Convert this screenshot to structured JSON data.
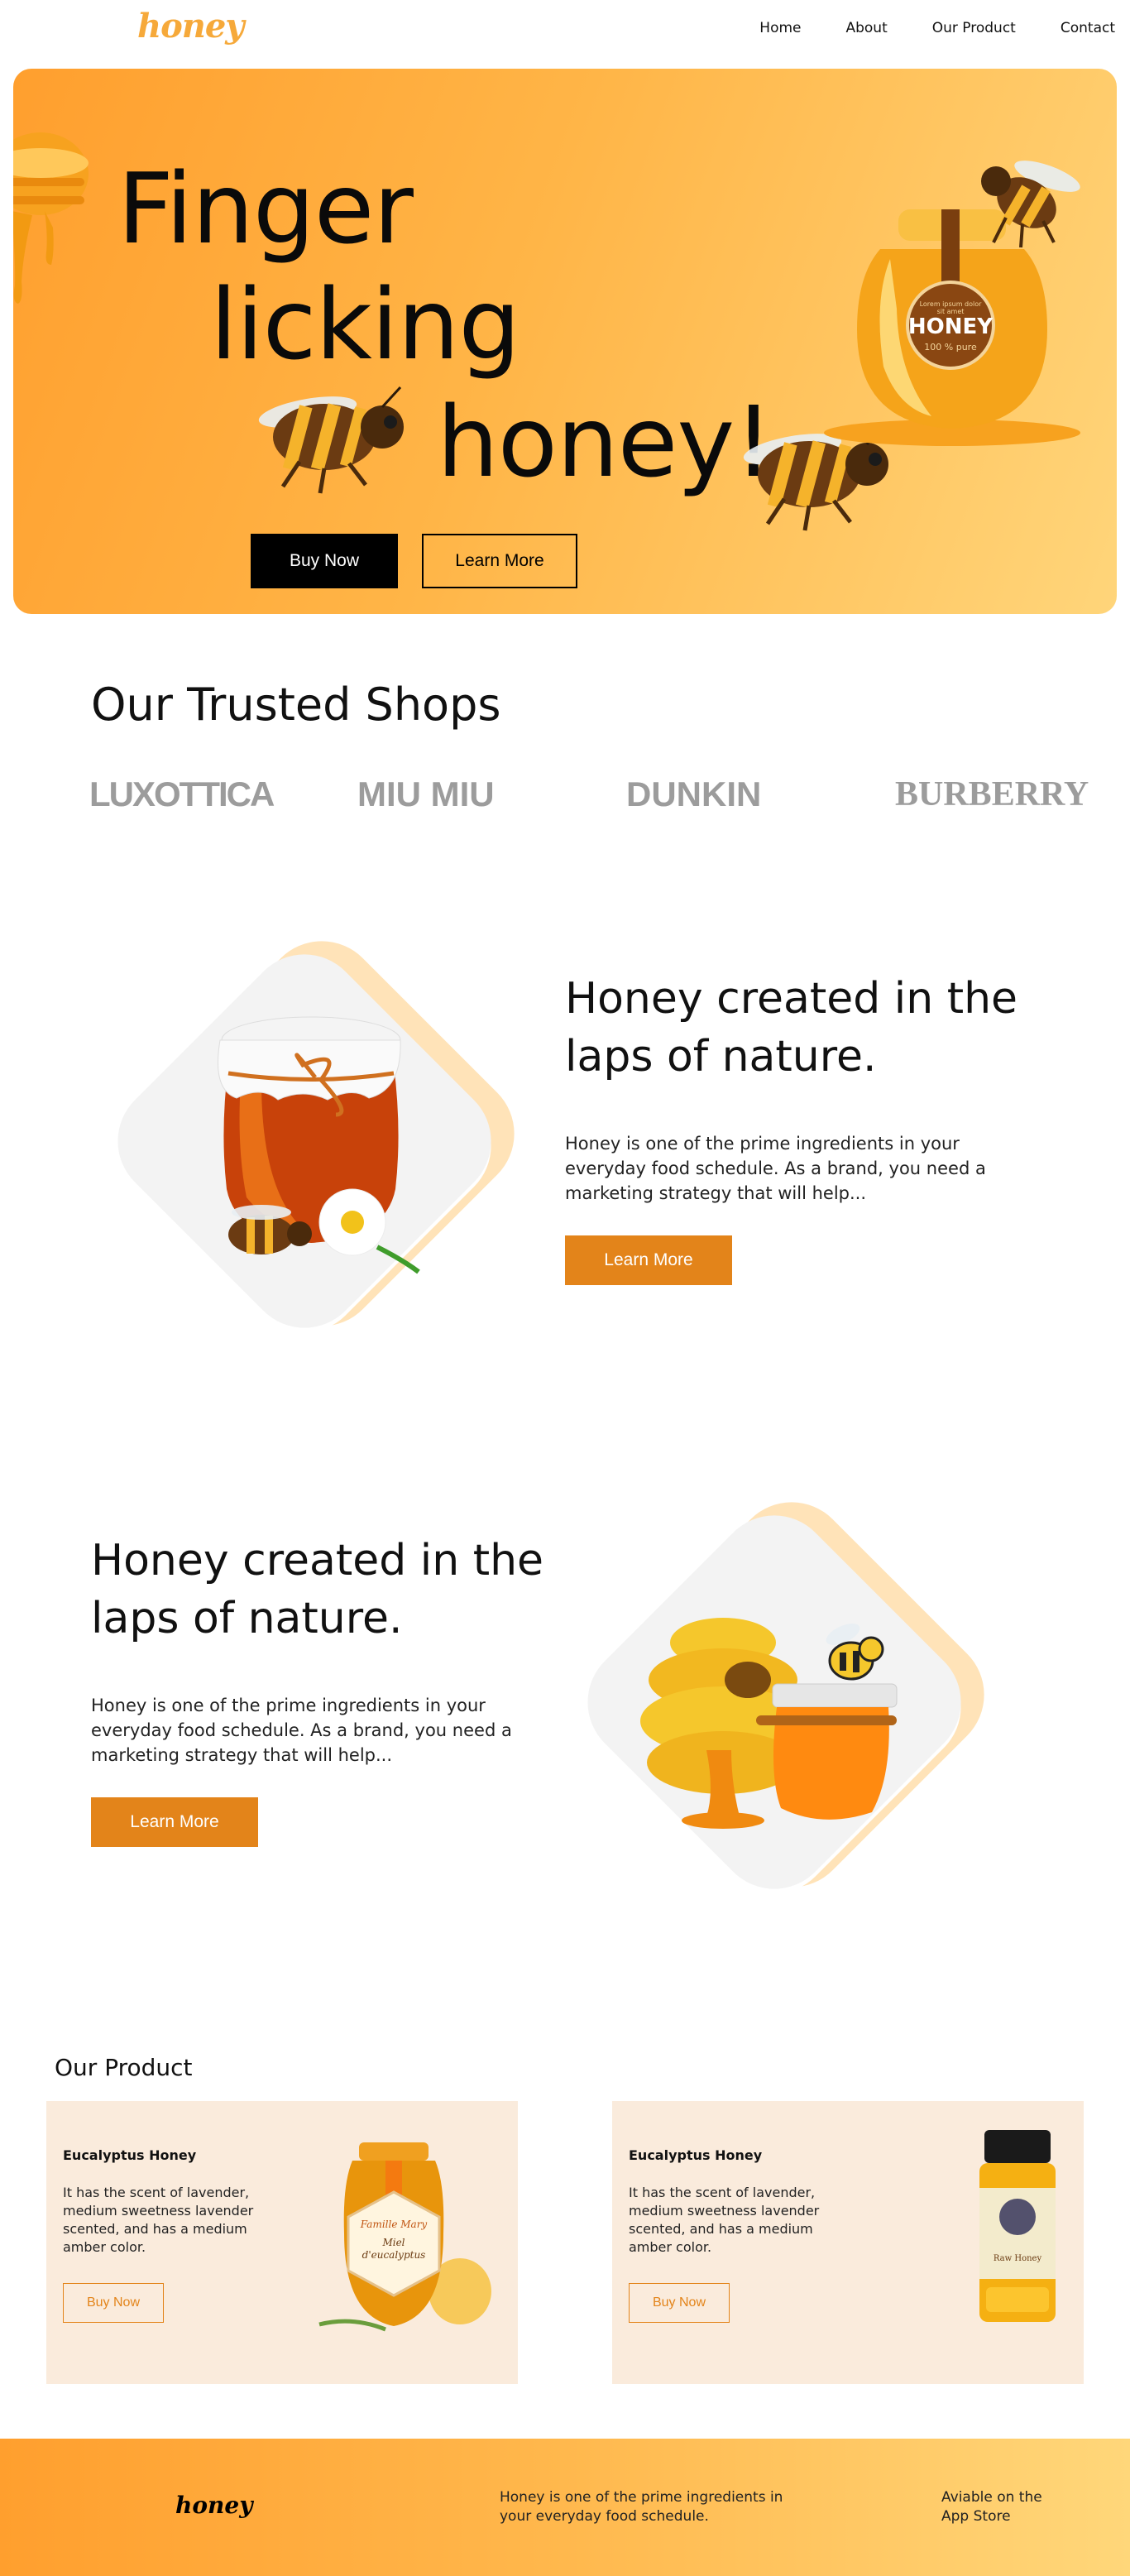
{
  "nav": {
    "logo": "honey",
    "links": [
      "Home",
      "About",
      "Our Product",
      "Contact"
    ]
  },
  "hero": {
    "line1": "Finger",
    "line2": "licking",
    "line3": "honey!",
    "buy_label": "Buy Now",
    "learn_label": "Learn More",
    "jar_label": "HONEY",
    "jar_sub": "100 % pure",
    "jar_small": "Lorem ipsum dolor sit amet"
  },
  "shops": {
    "title": "Our Trusted Shops",
    "brands": [
      "LUXOTTICA",
      "MIU MIU",
      "DUNKIN",
      "BURBERRY"
    ]
  },
  "feature1": {
    "title": "Honey created in the laps of nature.",
    "text": "Honey is one of the prime ingredients in your everyday food schedule. As a brand, you need a marketing strategy that will help...",
    "button": "Learn More"
  },
  "feature2": {
    "title": "Honey created in the laps of nature.",
    "text": "Honey is one of the prime ingredients in your everyday food schedule. As a brand, you need a marketing strategy that will help...",
    "button": "Learn More"
  },
  "products": {
    "heading": "Our Product",
    "items": [
      {
        "title": "Eucalyptus Honey",
        "text": "It has the scent of lavender, medium sweetness lavender scented, and has a medium amber color.",
        "button": "Buy Now",
        "jar_brand": "Famille Mary",
        "jar_name": "Miel d'eucalyptus"
      },
      {
        "title": "Eucalyptus Honey",
        "text": "It has the scent of lavender, medium sweetness lavender scented, and has a medium amber color.",
        "button": "Buy Now",
        "jar_name": "Raw Honey"
      }
    ]
  },
  "footer": {
    "logo": "honey",
    "text": "Honey is one of the prime ingredients in your everyday food schedule.",
    "store": "Aviable on the App Store"
  },
  "colors": {
    "accent": "#e3841a",
    "hero_start": "#ff9f2e",
    "hero_end": "#ffd57a",
    "card_bg": "#faebdc"
  }
}
